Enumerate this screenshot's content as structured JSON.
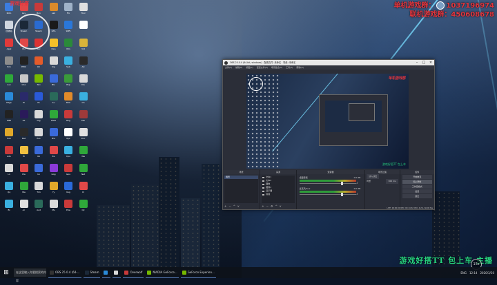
{
  "top_overlay": {
    "line1_label": "单机游戏群：",
    "line1_number": "1037196974",
    "line2_label": "联机游戏群：",
    "line2_number": "450608678",
    "small_red_text": "游戏好搭"
  },
  "bottom_banner": "游戏好搭TT 包上车 主播",
  "fps_badge": "15s",
  "desktop_icons": [
    {
      "label": "Roto",
      "color": "#3b7de0"
    },
    {
      "label": "Lay",
      "color": "#e04848"
    },
    {
      "label": "Ban",
      "color": "#c93a3a"
    },
    {
      "label": "Lad",
      "color": "#d98a2a"
    },
    {
      "label": "Fix",
      "color": "#9fb2c8"
    },
    {
      "label": "Tool",
      "color": "#e0e0e0"
    },
    {
      "label": "回收站",
      "color": "#cfd6df"
    },
    {
      "label": "Steam",
      "color": "#1b2838"
    },
    {
      "label": "Steam",
      "color": "#2a6bd1"
    },
    {
      "label": "GTA",
      "color": "#1a1a1a"
    },
    {
      "label": "WPS",
      "color": "#2a77d9"
    },
    {
      "label": "",
      "color": "#ffffff"
    },
    {
      "label": "Appl",
      "color": "#e03a3a"
    },
    {
      "label": "UU",
      "color": "#e04848"
    },
    {
      "label": "Rec",
      "color": "#d33"
    },
    {
      "label": "Dan",
      "color": "#f5c02a"
    },
    {
      "label": "Min",
      "color": "#2a8a3a"
    },
    {
      "label": "Vid",
      "color": "#d9b43a"
    },
    {
      "label": "Sim",
      "color": "#8c8c8c"
    },
    {
      "label": "EPIC",
      "color": "#222"
    },
    {
      "label": "Ori",
      "color": "#e35b2a"
    },
    {
      "label": "Sig",
      "color": "#d9d9d9"
    },
    {
      "label": "Sub",
      "color": "#3ab0e0"
    },
    {
      "label": "AX",
      "color": "#2a2a2a"
    },
    {
      "label": "Lux",
      "color": "#2fa83a"
    },
    {
      "label": "Gho",
      "color": "#c8c8c8"
    },
    {
      "label": "Nvi",
      "color": "#76b900"
    },
    {
      "label": "Blu",
      "color": "#3a6ad9"
    },
    {
      "label": "Exp",
      "color": "#3a9a3a"
    },
    {
      "label": "Dis",
      "color": "#d9d9d9"
    },
    {
      "label": "Edge",
      "color": "#2a8ad9"
    },
    {
      "label": "Pr",
      "color": "#2a2a6a"
    },
    {
      "label": "Ps",
      "color": "#2a5ad9"
    },
    {
      "label": "Au",
      "color": "#2a6a5a"
    },
    {
      "label": "Mob",
      "color": "#e08a2a"
    },
    {
      "label": "Ch",
      "color": "#3ab0e0"
    },
    {
      "label": "OBS",
      "color": "#222"
    },
    {
      "label": "Ae",
      "color": "#2a1a5a"
    },
    {
      "label": "Dig",
      "color": "#d9d9d9"
    },
    {
      "label": "Wwe",
      "color": "#2fa83a"
    },
    {
      "label": "Rog",
      "color": "#c93a3a"
    },
    {
      "label": "Msi",
      "color": "#9f3a3a"
    },
    {
      "label": "Pub",
      "color": "#e0a82a"
    },
    {
      "label": "Bat",
      "color": "#2a2a2a"
    },
    {
      "label": "Eso",
      "color": "#d9d9d9"
    },
    {
      "label": "Pho",
      "color": "#3a6ad9"
    },
    {
      "label": "Ryz",
      "color": "#ffffff"
    },
    {
      "label": "Doc",
      "color": "#e0e0e0"
    },
    {
      "label": "Ado",
      "color": "#c93a3a"
    },
    {
      "label": "Fil",
      "color": "#f0c040"
    },
    {
      "label": "Ub",
      "color": "#3a6ad9"
    },
    {
      "label": "Ea",
      "color": "#e04848"
    },
    {
      "label": "Cpu",
      "color": "#3ab0e0"
    },
    {
      "label": "Wa",
      "color": "#2fa83a"
    },
    {
      "label": "Lo",
      "color": "#d9d9d9"
    },
    {
      "label": "Pla",
      "color": "#e04848"
    },
    {
      "label": "Iw",
      "color": "#3a6ad9"
    },
    {
      "label": "Gog",
      "color": "#8a3ad9"
    },
    {
      "label": "Gpu",
      "color": "#c93a3a"
    },
    {
      "label": "Net",
      "color": "#2fa83a"
    },
    {
      "label": "Qq",
      "color": "#3ab0e0"
    },
    {
      "label": "We",
      "color": "#2fa83a"
    },
    {
      "label": "Tim",
      "color": "#d9d9d9"
    },
    {
      "label": "Yy",
      "color": "#e0a82a"
    },
    {
      "label": "Kug",
      "color": "#2a6ad9"
    },
    {
      "label": "Cl",
      "color": "#e04848"
    },
    {
      "label": "Bi",
      "color": "#3ab0e0"
    },
    {
      "label": "Ac",
      "color": "#e0e0e0"
    },
    {
      "label": "Aud",
      "color": "#2a6a5a"
    },
    {
      "label": "Ms",
      "color": "#d9d9d9"
    },
    {
      "label": "Pow",
      "color": "#c93a3a"
    },
    {
      "label": "Qz",
      "color": "#2fa83a"
    }
  ],
  "obs": {
    "title": "OBS 25.0.4 (64-bit, windows) - 配置文件: 未命名 - 场景: 未命名",
    "menu": [
      "文件(F)",
      "编辑(E)",
      "视图(V)",
      "配置文件(P)",
      "场景集合(S)",
      "工具(T)",
      "帮助(H)"
    ],
    "preview_red": "单机游戏群",
    "preview_green": "游戏好搭TT 包上车",
    "docks": {
      "scenes_title": "场景",
      "scene_items": [
        "场景"
      ],
      "sources_title": "来源",
      "source_items": [
        "文本1",
        "文本2",
        "图像",
        "图像2",
        "显示器",
        "音频"
      ],
      "mixer_title": "混音器",
      "mixer_rows": [
        {
          "name": "桌面音频",
          "db": "0.0 dB"
        },
        {
          "name": "麦克风/Aux",
          "db": "0.0 dB"
        }
      ],
      "transitions_title": "场景过渡",
      "transition_type": "淡入淡出",
      "duration_label": "时长",
      "duration_value": "300 ms",
      "controls_title": "控件",
      "controls": [
        "开始推流",
        "停止录制",
        "工作室模式",
        "设置",
        "退出"
      ],
      "status": "LIVE: 00:00:00  REC: 00:14:32  CPU: 4.2%, 60.00 fps"
    }
  },
  "taskbar": {
    "search": "在这里输入你要搜索的内容",
    "items": [
      {
        "label": "OBS 25.0.4 (64-...",
        "color": "#333"
      },
      {
        "label": "Steam",
        "color": "#1b2838"
      },
      {
        "label": "",
        "color": "#2a8ad9"
      },
      {
        "label": "",
        "color": "#d9d9d9"
      },
      {
        "label": "Overwolf",
        "color": "#c93a3a"
      },
      {
        "label": "NVIDIA GeForce...",
        "color": "#76b900"
      },
      {
        "label": "GeForce Experien...",
        "color": "#76b900"
      }
    ],
    "tray": [
      "ENG",
      "12:14",
      "2020/3/30"
    ]
  }
}
